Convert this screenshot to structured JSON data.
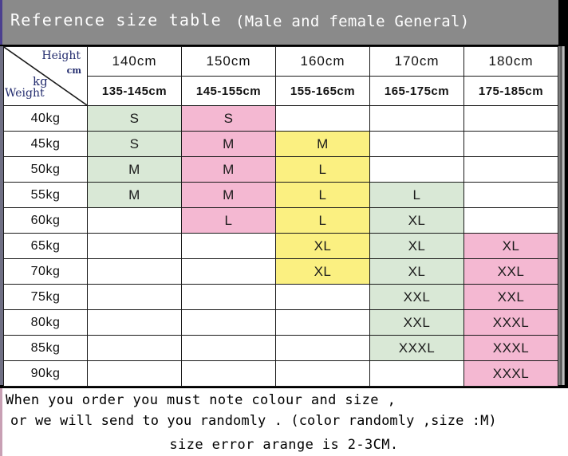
{
  "title": {
    "main": "Reference size table",
    "sub": "(Male and female General)",
    "bar_color": "#8a8a8a"
  },
  "corner": {
    "height_label": "Height",
    "height_unit": "cm",
    "weight_label": "Weight",
    "weight_unit": "kg"
  },
  "palette": {
    "green": "#d9e8d6",
    "pink": "#f4b8d2",
    "yellow": "#fbf081",
    "empty": "#ffffff"
  },
  "chart_data": {
    "type": "table",
    "title": "Reference size table (Male and female General)",
    "xlabel": "Height cm",
    "ylabel": "Weight kg",
    "column_headers": [
      "140cm",
      "150cm",
      "160cm",
      "170cm",
      "180cm"
    ],
    "column_subheaders": [
      "135-145cm",
      "145-155cm",
      "155-165cm",
      "165-175cm",
      "175-185cm"
    ],
    "column_colors": [
      "green",
      "pink",
      "yellow",
      "green",
      "pink"
    ],
    "row_headers": [
      "40kg",
      "45kg",
      "50kg",
      "55kg",
      "60kg",
      "65kg",
      "70kg",
      "75kg",
      "80kg",
      "85kg",
      "90kg"
    ],
    "rows": [
      {
        "weight": "40kg",
        "cells": [
          {
            "value": "S",
            "color": "green"
          },
          {
            "value": "S",
            "color": "pink"
          },
          {
            "value": "",
            "color": "empty"
          },
          {
            "value": "",
            "color": "empty"
          },
          {
            "value": "",
            "color": "empty"
          }
        ]
      },
      {
        "weight": "45kg",
        "cells": [
          {
            "value": "S",
            "color": "green"
          },
          {
            "value": "M",
            "color": "pink"
          },
          {
            "value": "M",
            "color": "yellow"
          },
          {
            "value": "",
            "color": "empty"
          },
          {
            "value": "",
            "color": "empty"
          }
        ]
      },
      {
        "weight": "50kg",
        "cells": [
          {
            "value": "M",
            "color": "green"
          },
          {
            "value": "M",
            "color": "pink"
          },
          {
            "value": "L",
            "color": "yellow"
          },
          {
            "value": "",
            "color": "empty"
          },
          {
            "value": "",
            "color": "empty"
          }
        ]
      },
      {
        "weight": "55kg",
        "cells": [
          {
            "value": "M",
            "color": "green"
          },
          {
            "value": "M",
            "color": "pink"
          },
          {
            "value": "L",
            "color": "yellow"
          },
          {
            "value": "L",
            "color": "green"
          },
          {
            "value": "",
            "color": "empty"
          }
        ]
      },
      {
        "weight": "60kg",
        "cells": [
          {
            "value": "",
            "color": "empty"
          },
          {
            "value": "L",
            "color": "pink"
          },
          {
            "value": "L",
            "color": "yellow"
          },
          {
            "value": "XL",
            "color": "green"
          },
          {
            "value": "",
            "color": "empty"
          }
        ]
      },
      {
        "weight": "65kg",
        "cells": [
          {
            "value": "",
            "color": "empty"
          },
          {
            "value": "",
            "color": "empty"
          },
          {
            "value": "XL",
            "color": "yellow"
          },
          {
            "value": "XL",
            "color": "green"
          },
          {
            "value": "XL",
            "color": "pink"
          }
        ]
      },
      {
        "weight": "70kg",
        "cells": [
          {
            "value": "",
            "color": "empty"
          },
          {
            "value": "",
            "color": "empty"
          },
          {
            "value": "XL",
            "color": "yellow"
          },
          {
            "value": "XL",
            "color": "green"
          },
          {
            "value": "XXL",
            "color": "pink"
          }
        ]
      },
      {
        "weight": "75kg",
        "cells": [
          {
            "value": "",
            "color": "empty"
          },
          {
            "value": "",
            "color": "empty"
          },
          {
            "value": "",
            "color": "empty"
          },
          {
            "value": "XXL",
            "color": "green"
          },
          {
            "value": "XXL",
            "color": "pink"
          }
        ]
      },
      {
        "weight": "80kg",
        "cells": [
          {
            "value": "",
            "color": "empty"
          },
          {
            "value": "",
            "color": "empty"
          },
          {
            "value": "",
            "color": "empty"
          },
          {
            "value": "XXL",
            "color": "green"
          },
          {
            "value": "XXXL",
            "color": "pink"
          }
        ]
      },
      {
        "weight": "85kg",
        "cells": [
          {
            "value": "",
            "color": "empty"
          },
          {
            "value": "",
            "color": "empty"
          },
          {
            "value": "",
            "color": "empty"
          },
          {
            "value": "XXXL",
            "color": "green"
          },
          {
            "value": "XXXL",
            "color": "pink"
          }
        ]
      },
      {
        "weight": "90kg",
        "cells": [
          {
            "value": "",
            "color": "empty"
          },
          {
            "value": "",
            "color": "empty"
          },
          {
            "value": "",
            "color": "empty"
          },
          {
            "value": "",
            "color": "empty"
          },
          {
            "value": "XXXL",
            "color": "pink"
          }
        ]
      }
    ]
  },
  "footer": {
    "line1": "When you order you must note colour and size ,",
    "line2": "or we will send to you randomly . (color randomly ,size :M)",
    "line3": "size error arange is 2-3CM."
  }
}
